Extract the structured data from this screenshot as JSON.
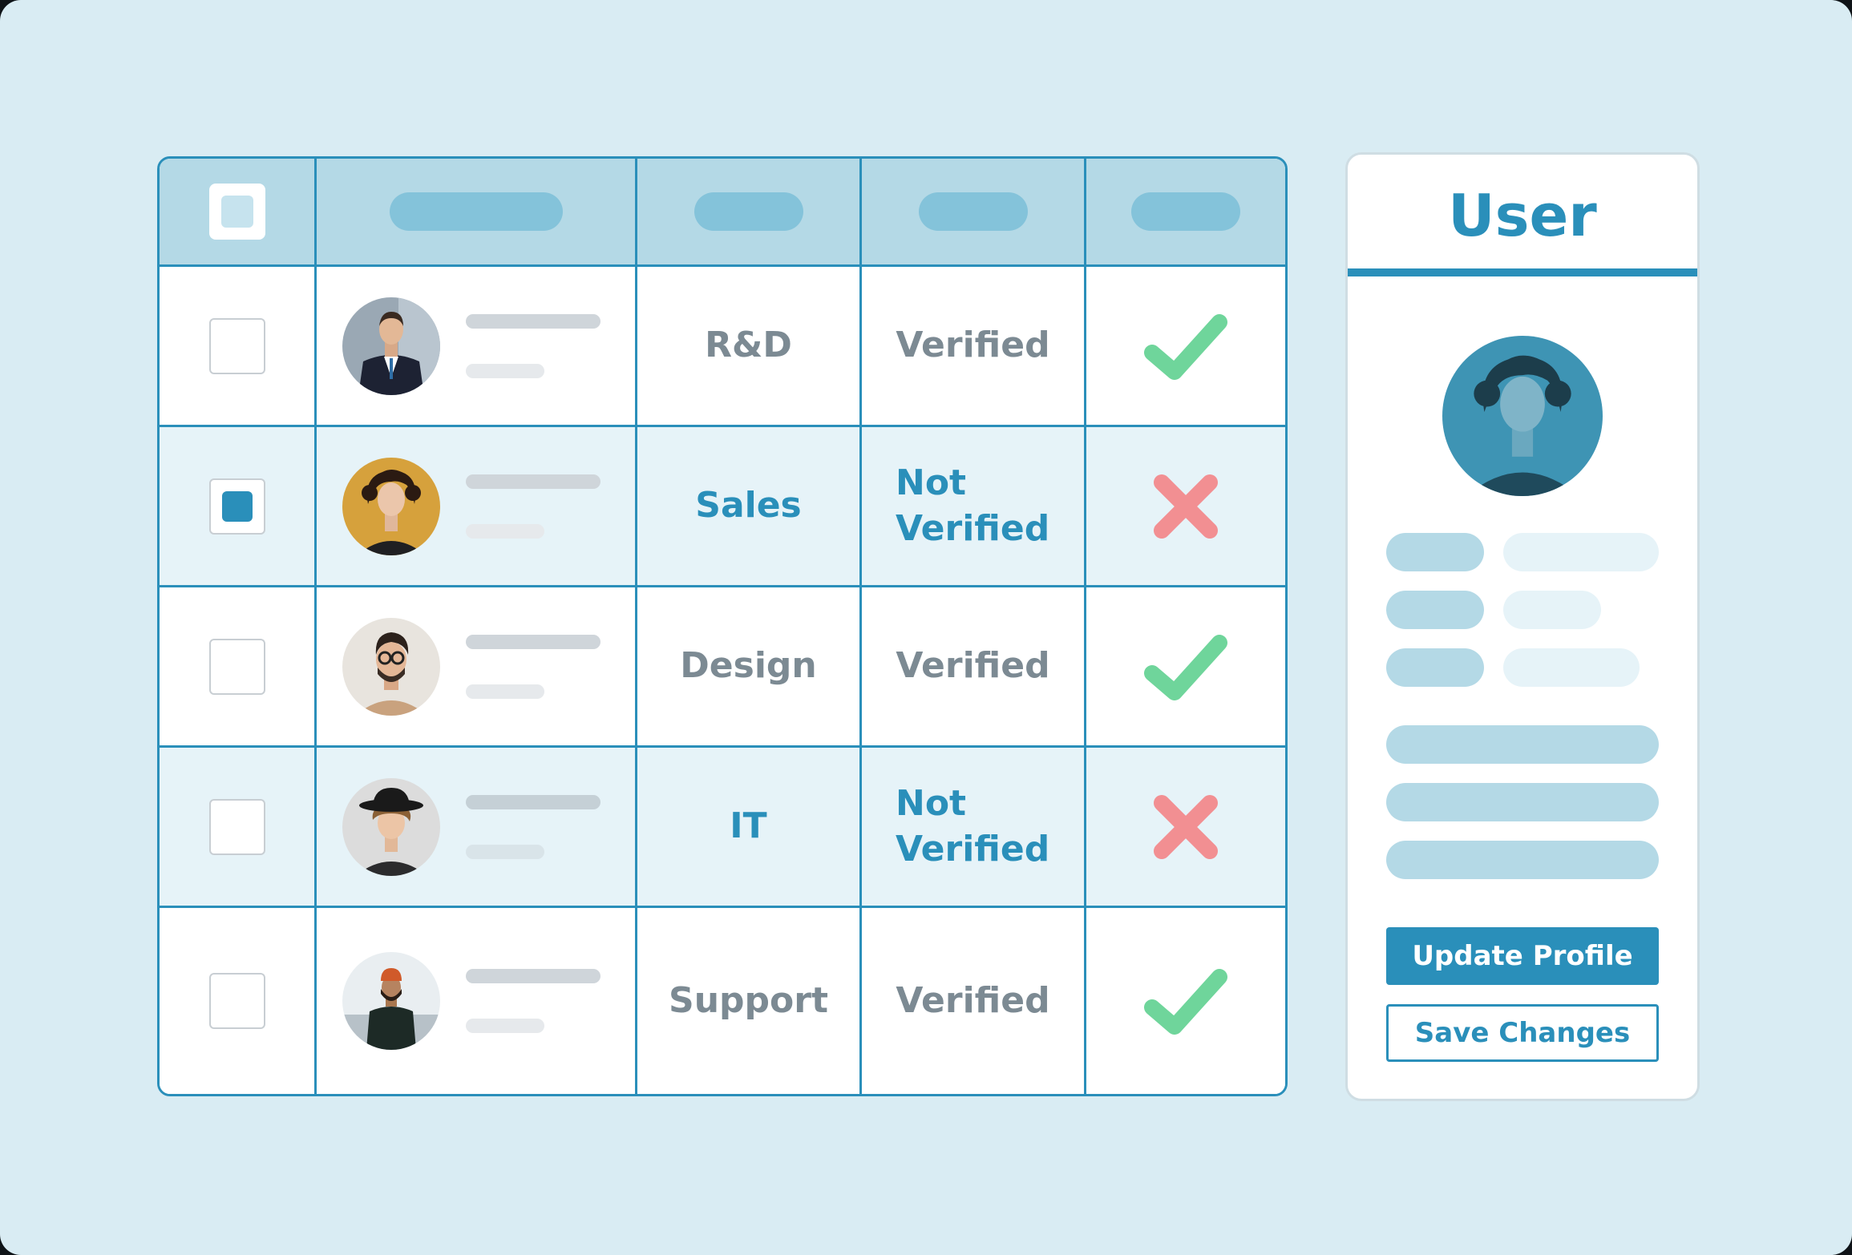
{
  "table": {
    "header": {
      "select_all_checked": false
    },
    "rows": [
      {
        "selected": false,
        "avatar": "portrait-man-suit",
        "department": "R&D",
        "status": "Verified",
        "verified": true,
        "status_icon": "check-icon"
      },
      {
        "selected": true,
        "avatar": "portrait-woman-curly",
        "department": "Sales",
        "status": "Not Verified",
        "verified": false,
        "status_icon": "cross-icon"
      },
      {
        "selected": false,
        "avatar": "portrait-man-glasses",
        "department": "Design",
        "status": "Verified",
        "verified": true,
        "status_icon": "check-icon"
      },
      {
        "selected": false,
        "avatar": "portrait-man-hat",
        "department": "IT",
        "status": "Not Verified",
        "verified": false,
        "status_icon": "cross-icon"
      },
      {
        "selected": false,
        "avatar": "portrait-man-beanie",
        "department": "Support",
        "status": "Verified",
        "verified": true,
        "status_icon": "check-icon"
      }
    ]
  },
  "panel": {
    "title": "User",
    "avatar": "portrait-woman-curly",
    "update_label": "Update Profile",
    "save_label": "Save Changes"
  },
  "colors": {
    "accent": "#2a8fba",
    "verified": "#6fd59b",
    "not_verified": "#f28f92",
    "muted_text": "#7c8a93"
  }
}
